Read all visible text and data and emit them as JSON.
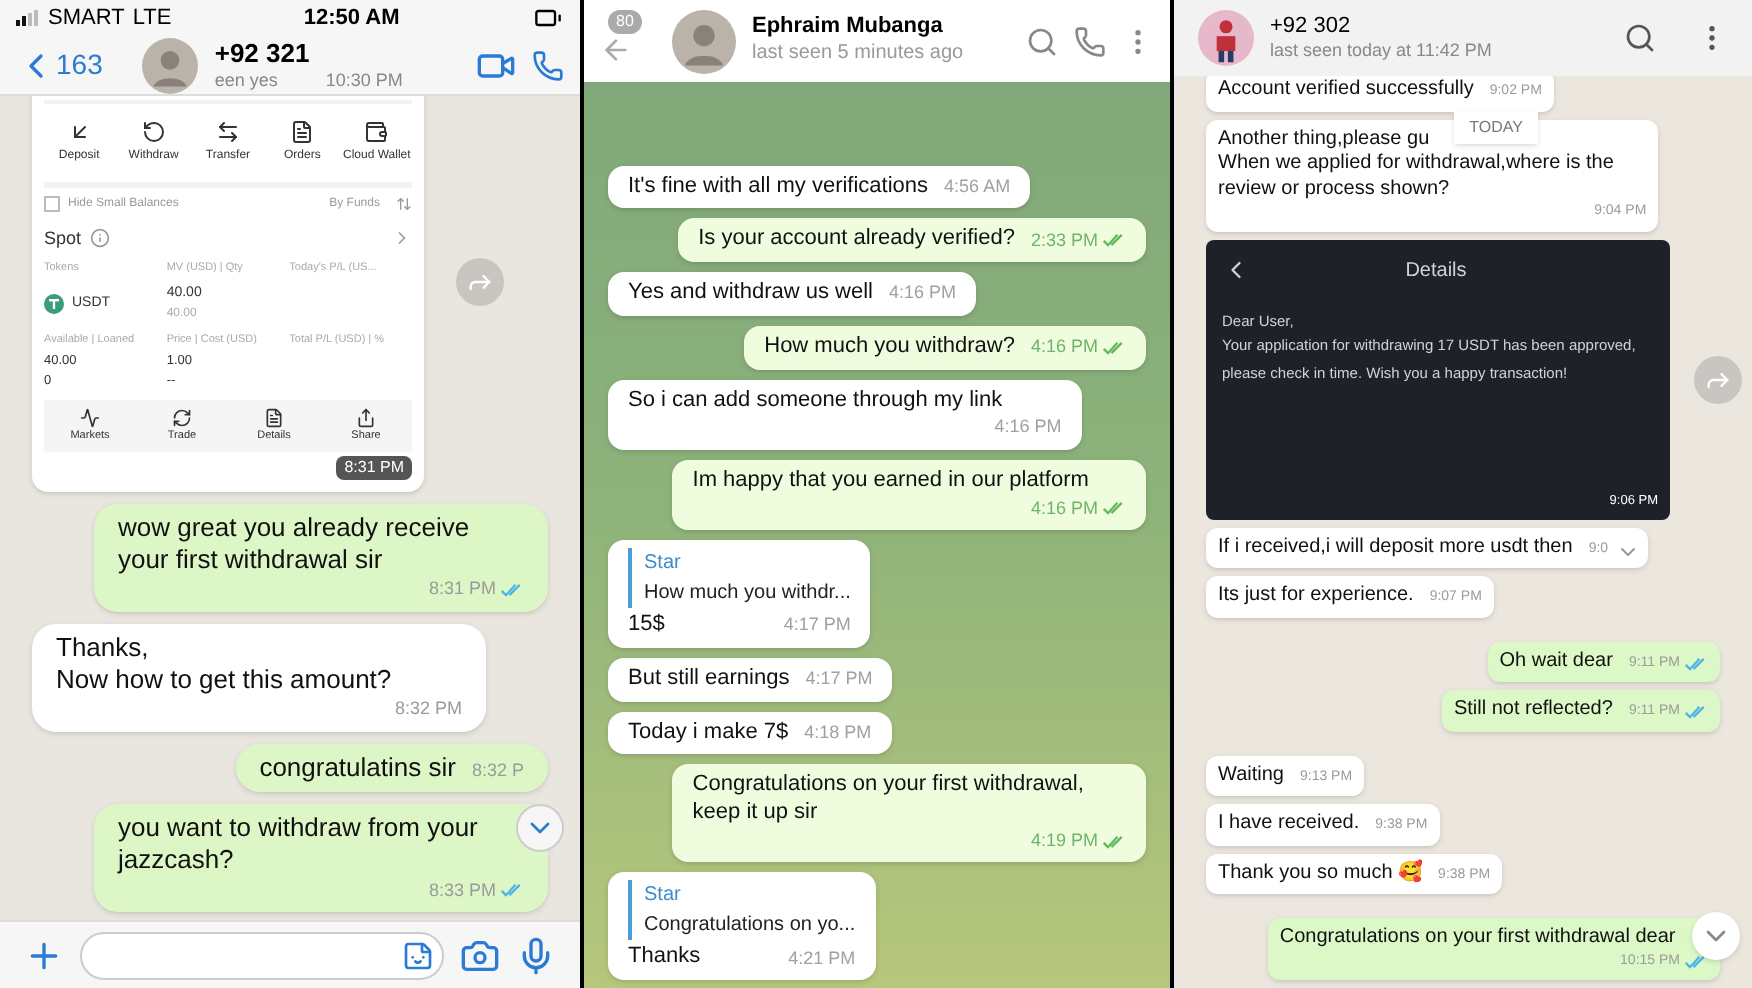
{
  "left_chat": {
    "status_bar": {
      "carrier": "SMART",
      "network": "LTE",
      "time": "12:50 AM"
    },
    "header": {
      "back_count": "163",
      "name": "+92 321",
      "status": "een yes",
      "status_time": "10:30 PM"
    },
    "messages": [
      {
        "kind": "exchange_screenshot",
        "outgoing": false,
        "time": "8:31 PM",
        "actions": [
          "Deposit",
          "Withdraw",
          "Transfer",
          "Orders",
          "Cloud Wallet"
        ],
        "hide_small": {
          "label": "Hide Small Balances",
          "checked": false
        },
        "sort": "By Funds",
        "section": "Spot",
        "columns": [
          "Tokens",
          "MV (USD) | Qty",
          "Today's P/L (US..."
        ],
        "token": "USDT",
        "value": "40.00",
        "qty": "40.00",
        "columns2": [
          "Available | Loaned",
          "Price | Cost (USD)",
          "Total P/L (USD) | %"
        ],
        "available": "40.00",
        "loaned": "0",
        "price": "1.00",
        "cost": "--",
        "nav": [
          "Markets",
          "Trade",
          "Details",
          "Share"
        ]
      },
      {
        "kind": "text",
        "outgoing": true,
        "text": "wow great you already receive your first withdrawal sir",
        "time": "8:31 PM",
        "read": true
      },
      {
        "kind": "text",
        "outgoing": false,
        "text": "Thanks,\nNow how to get this amount?",
        "time": "8:32 PM"
      },
      {
        "kind": "text",
        "outgoing": true,
        "text": "congratulatins sir",
        "time": "8:32 P"
      },
      {
        "kind": "text",
        "outgoing": true,
        "text": "you want to withdraw from your jazzcash?",
        "time": "8:33 PM",
        "read": true
      }
    ]
  },
  "middle_chat": {
    "header": {
      "unread_count": "80",
      "name": "Ephraim Mubanga",
      "status": "last seen 5 minutes ago"
    },
    "messages": [
      {
        "kind": "text",
        "outgoing": false,
        "text": "It's fine with all my verifications",
        "time": "4:56 AM"
      },
      {
        "kind": "text",
        "outgoing": true,
        "text": "Is your account already verified?",
        "time": "2:33 PM",
        "read": true
      },
      {
        "kind": "text",
        "outgoing": false,
        "text": "Yes and withdraw us well",
        "time": "4:16 PM"
      },
      {
        "kind": "text",
        "outgoing": true,
        "text": "How much you withdraw?",
        "time": "4:16 PM",
        "read": true
      },
      {
        "kind": "text",
        "outgoing": false,
        "text": "So i can add someone through my link",
        "time": "4:16 PM"
      },
      {
        "kind": "text",
        "outgoing": true,
        "text": "Im happy that you earned in our platform",
        "time": "4:16 PM",
        "read": true
      },
      {
        "kind": "reply",
        "outgoing": false,
        "quote_author": "Star",
        "quote_text": "How much you withdr...",
        "text": "15$",
        "time": "4:17 PM"
      },
      {
        "kind": "text",
        "outgoing": false,
        "text": "But still earnings",
        "time": "4:17 PM"
      },
      {
        "kind": "text",
        "outgoing": false,
        "text": "Today i make 7$",
        "time": "4:18 PM"
      },
      {
        "kind": "text",
        "outgoing": true,
        "text": "Congratulations on your first withdrawal, keep it up sir",
        "time": "4:19 PM",
        "read": true
      },
      {
        "kind": "reply",
        "outgoing": false,
        "quote_author": "Star",
        "quote_text": "Congratulations on yo...",
        "text": "Thanks",
        "time": "4:21 PM"
      }
    ]
  },
  "right_chat": {
    "header": {
      "name": "+92 302",
      "status": "last seen today at 11:42 PM"
    },
    "date_chip": "TODAY",
    "messages": [
      {
        "kind": "text",
        "outgoing": false,
        "text": "Account verified successfully",
        "time": "9:02 PM",
        "hovered": false
      },
      {
        "kind": "dated",
        "outgoing": false,
        "lines": [
          "Another thing,please gu",
          "When we applied for withdrawal,where is the review or process  shown?"
        ],
        "time": "9:04 PM",
        "hovered": false
      },
      {
        "kind": "notice_screenshot",
        "outgoing": false,
        "title": "Details",
        "greeting": "Dear User,",
        "body": "Your application for withdrawing 17 USDT has been approved, please check in time. Wish you a happy transaction!",
        "time": "9:06 PM"
      },
      {
        "kind": "text",
        "outgoing": false,
        "text": "If i received,i will deposit more usdt then",
        "time": "9:0",
        "hovered": true
      },
      {
        "kind": "text",
        "outgoing": false,
        "text": "Its just for experience.",
        "time": "9:07 PM",
        "hovered": false
      },
      {
        "kind": "text",
        "outgoing": true,
        "text": "Oh wait dear",
        "time": "9:11 PM",
        "read": true,
        "hovered": false
      },
      {
        "kind": "text",
        "outgoing": true,
        "text": "Still not reflected?",
        "time": "9:11 PM",
        "read": true,
        "hovered": false
      },
      {
        "kind": "text",
        "outgoing": false,
        "text": "Waiting",
        "time": "9:13 PM",
        "hovered": false
      },
      {
        "kind": "text",
        "outgoing": false,
        "text": "I have received.",
        "time": "9:38 PM",
        "hovered": false
      },
      {
        "kind": "text",
        "outgoing": false,
        "text": "Thank you so much 🥰",
        "time": "9:38 PM",
        "hovered": false
      },
      {
        "kind": "text",
        "outgoing": true,
        "text": "Congratulations on your first withdrawal dear",
        "time": "10:15 PM",
        "read": true,
        "hovered": false
      }
    ]
  }
}
